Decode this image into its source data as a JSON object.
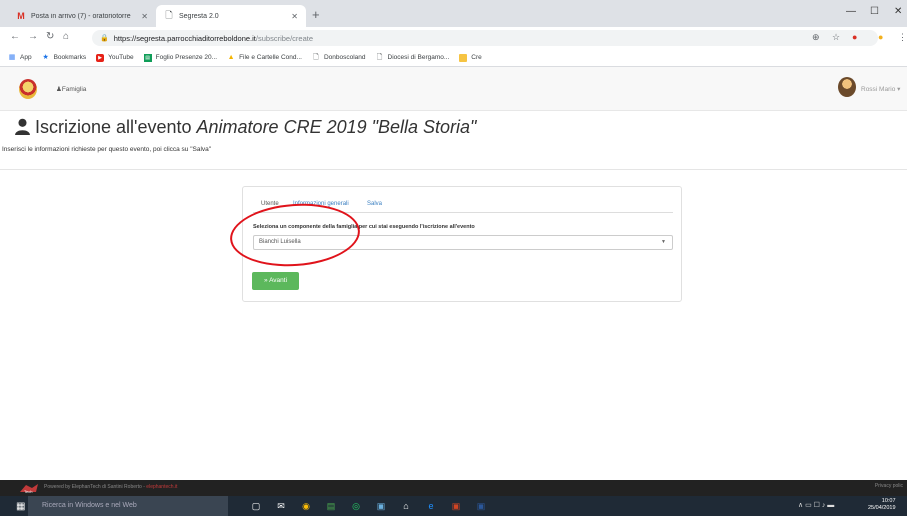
{
  "browser": {
    "tabs": [
      {
        "title": "Posta in arrivo (7) - oratoriotorre",
        "icon": "gmail-icon"
      },
      {
        "title": "Segresta 2.0",
        "icon": "page-icon"
      }
    ],
    "url_host": "https://segresta.parrocchiaditorreboldone.it",
    "url_path": "/subscribe/create",
    "bookmarks": [
      {
        "label": "App",
        "icon": "apps-grid-icon"
      },
      {
        "label": "Bookmarks",
        "icon": "star-icon"
      },
      {
        "label": "YouTube",
        "icon": "youtube-icon"
      },
      {
        "label": "Foglio Presenze 20...",
        "icon": "sheets-icon"
      },
      {
        "label": "File e Cartelle Cond...",
        "icon": "drive-icon"
      },
      {
        "label": "Donboscoland",
        "icon": "page-icon"
      },
      {
        "label": "Diocesi di Bergamo...",
        "icon": "page-icon"
      },
      {
        "label": "Cre",
        "icon": "folder-icon"
      }
    ]
  },
  "nav": {
    "famiglia": "Famiglia",
    "user": "Rossi Mario"
  },
  "page": {
    "title": "Iscrizione all'evento",
    "event": "Animatore CRE 2019 \"Bella Storia\"",
    "subtitle": "Inserisci le informazioni richieste per questo evento, poi clicca su \"Salva\""
  },
  "form": {
    "tabs": [
      "Utente",
      "Informazioni generali",
      "Salva"
    ],
    "label": "Seleziona un componente della famiglia per cui stai eseguendo l'iscrizione all'evento",
    "selected": "Bianchi Luisella",
    "button": "Avanti",
    "button_glyph": "»"
  },
  "footer": {
    "text_prefix": "Powered by ElephanTech di Santini Roberto - ",
    "link": "elephantech.it",
    "logo_label": "Tech",
    "privacy": "Privacy polic"
  },
  "taskbar": {
    "search": "Ricerca in Windows e nel Web",
    "time": "10:07",
    "date": "25/04/2019"
  },
  "colors": {
    "accent_green": "#5cb85c",
    "annotation_red": "#e0131b",
    "link_blue": "#3a7fc1"
  }
}
